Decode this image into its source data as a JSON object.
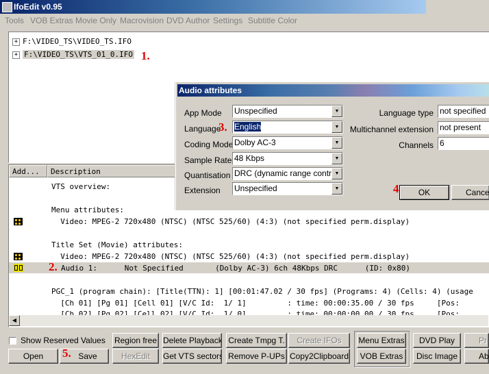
{
  "window": {
    "title": "IfoEdit v0.95"
  },
  "menu": [
    "Tools",
    "VOB Extras",
    "Movie Only",
    "Macrovision",
    "DVD Author",
    "Settings",
    "Subtitle Color"
  ],
  "tree": {
    "items": [
      {
        "path": "F:\\VIDEO_TS\\VIDEO_TS.IFO",
        "expander": "+"
      },
      {
        "path": "F:\\VIDEO_TS\\VTS_01_0.IFO",
        "expander": "+"
      }
    ]
  },
  "list": {
    "columns": [
      "Add...",
      "Description"
    ],
    "lines": [
      "VTS overview:",
      "Menu attributes:",
      "  Video: MPEG-2 720x480 (NTSC) (NTSC 525/60) (4:3) (not specified perm.display)",
      "Title Set (Movie) attributes:",
      "  Video: MPEG-2 720x480 (NTSC) (NTSC 525/60) (4:3) (not specified perm.display)",
      "Audio 1:      Not Specified       (Dolby AC-3) 6ch 48Kbps DRC      (ID: 0x80)",
      "PGC_1 (program chain): [Title(TTN): 1] [00:01:47.02 / 30 fps] (Programs: 4) (Cells: 4) (usage",
      "  [Ch 01] [Pg 01] [Cell 01] [V/C Id:  1/ 1]         : time: 00:00:35.00 / 30 fps     [Pos:",
      "  [Ch 02] [Pg 02] [Cell 02] [V/C Id:  1/ 0]         : time: 00:00:00.00 / 30 fps     [Pos:"
    ]
  },
  "bottom": {
    "show_reserved": "Show Reserved Values",
    "open": "Open",
    "save": "Save",
    "region_free": "Region free",
    "hexedit": "HexEdit",
    "delete_playback": "Delete Playback",
    "get_vts_sectors": "Get VTS sectors",
    "create_tmpg": "Create Tmpg T.",
    "remove_pups": "Remove P-UPs",
    "create_ifos": "Create IFOs",
    "copy2clipboard": "Copy2Clipboard",
    "menu_extras": "Menu Extras",
    "vob_extras": "VOB Extras",
    "dvd_play": "DVD Play",
    "disc_image": "Disc Image",
    "pre": "Pre",
    "abo": "Abo"
  },
  "dialog": {
    "title": "Audio attributes",
    "app_mode_label": "App Mode",
    "app_mode_value": "Unspecified",
    "language_label": "Language",
    "language_value": "English",
    "coding_mode_label": "Coding Mode",
    "coding_mode_value": "Dolby AC-3",
    "sample_rate_label": "Sample Rate",
    "sample_rate_value": "48 Kbps",
    "quantisation_label": "Quantisation",
    "quantisation_value": "DRC (dynamic range control)",
    "extension_label": "Extension",
    "extension_value": "Unspecified",
    "language_type_label": "Language type",
    "language_type_value": "not specified",
    "multichannel_label": "Multichannel extension",
    "multichannel_value": "not present",
    "channels_label": "Channels",
    "channels_value": "6",
    "ok": "OK",
    "cancel": "Cancel"
  },
  "annotations": [
    "1.",
    "2.",
    "3.",
    "4.",
    "5."
  ]
}
